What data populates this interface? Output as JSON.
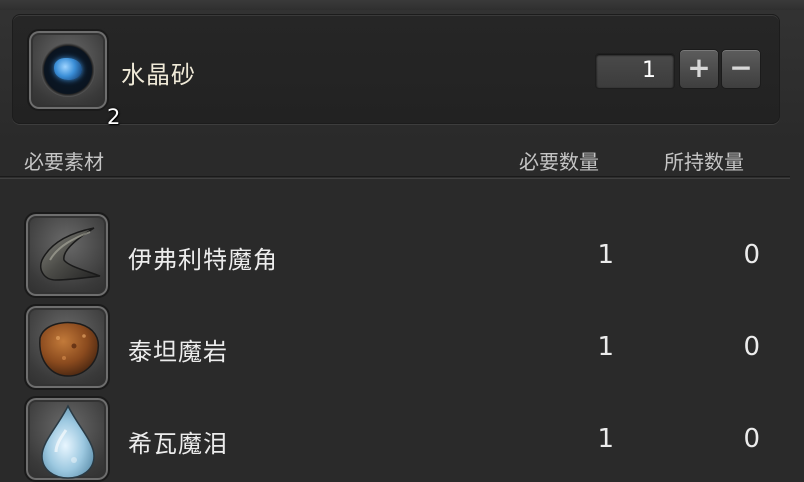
{
  "product": {
    "name": "水晶砂",
    "icon": "crystal-sand-icon",
    "yield": "2",
    "quantity": "1",
    "plus_label": "+",
    "minus_label": "−"
  },
  "headers": {
    "materials": "必要素材",
    "required": "必要数量",
    "owned": "所持数量"
  },
  "materials": [
    {
      "name": "伊弗利特魔角",
      "icon": "horn-icon",
      "required": "1",
      "owned": "0"
    },
    {
      "name": "泰坦魔岩",
      "icon": "rock-icon",
      "required": "1",
      "owned": "0"
    },
    {
      "name": "希瓦魔泪",
      "icon": "teardrop-gem-icon",
      "required": "1",
      "owned": "0"
    }
  ],
  "colors": {
    "background": "#2c2c2c",
    "text": "#ececec",
    "product_name": "#f0ead8",
    "crystal_blue": "#3b8fd8"
  }
}
